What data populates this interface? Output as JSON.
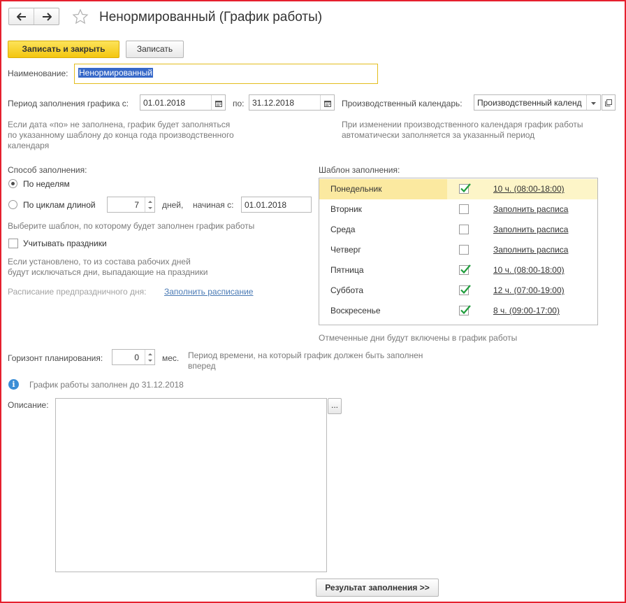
{
  "window": {
    "title": "Ненормированный (График работы)"
  },
  "toolbar": {
    "save_close_label": "Записать и закрыть",
    "save_label": "Записать"
  },
  "name": {
    "label": "Наименование:",
    "value": "Ненормированный"
  },
  "period": {
    "from_label": "Период заполнения графика с:",
    "from_value": "01.01.2018",
    "to_label": "по:",
    "to_value": "31.12.2018",
    "hint": [
      "Если дата «по» не заполнена, график будет заполняться",
      "по указанному шаблону до конца года производственного",
      "календаря"
    ]
  },
  "calendar": {
    "label": "Производственный календарь:",
    "value": "Производственный календ",
    "hint": [
      "При изменении производственного календаря график работы",
      "автоматически заполняется за указанный период"
    ]
  },
  "fill_method": {
    "label": "Способ заполнения:",
    "by_weeks_label": "По неделям",
    "by_weeks_selected": true,
    "by_cycles_label": "По циклам длиной",
    "cycle_length": "7",
    "days_label": "дней,",
    "start_label": "начиная с:",
    "start_value": "01.01.2018",
    "template_hint": "Выберите шаблон, по которому будет заполнен график работы"
  },
  "holidays": {
    "label": "Учитывать праздники",
    "checked": false,
    "hint": [
      "Если установлено, то из состава рабочих дней",
      "будут исключаться дни, выпадающие на праздники"
    ],
    "pre_holiday_label": "Расписание предпраздничного дня:",
    "pre_holiday_link": "Заполнить расписание"
  },
  "template": {
    "label": "Шаблон заполнения:",
    "days": [
      {
        "name": "Понедельник",
        "checked": true,
        "schedule": "10 ч. (08:00-18:00)"
      },
      {
        "name": "Вторник",
        "checked": false,
        "schedule": "Заполнить расписа"
      },
      {
        "name": "Среда",
        "checked": false,
        "schedule": "Заполнить расписа"
      },
      {
        "name": "Четверг",
        "checked": false,
        "schedule": "Заполнить расписа"
      },
      {
        "name": "Пятница",
        "checked": true,
        "schedule": "10 ч. (08:00-18:00)"
      },
      {
        "name": "Суббота",
        "checked": true,
        "schedule": "12 ч. (07:00-19:00)"
      },
      {
        "name": "Воскресенье",
        "checked": true,
        "schedule": "8 ч. (09:00-17:00)"
      }
    ],
    "hint": "Отмеченные дни будут включены в график работы"
  },
  "horizon": {
    "label": "Горизонт планирования:",
    "value": "0",
    "unit": "мес.",
    "hint": [
      "Период времени, на который график должен быть заполнен",
      "вперед"
    ]
  },
  "info": {
    "text": "График работы заполнен до 31.12.2018"
  },
  "description": {
    "label": "Описание:",
    "value": "",
    "more_label": "..."
  },
  "result_button": {
    "label": "Результат заполнения >>"
  },
  "colors": {
    "accent_yellow": "#f8d21c",
    "check_green": "#1f9e3c",
    "frame_red": "#e5202e",
    "link_blue": "#4b7bb5"
  }
}
